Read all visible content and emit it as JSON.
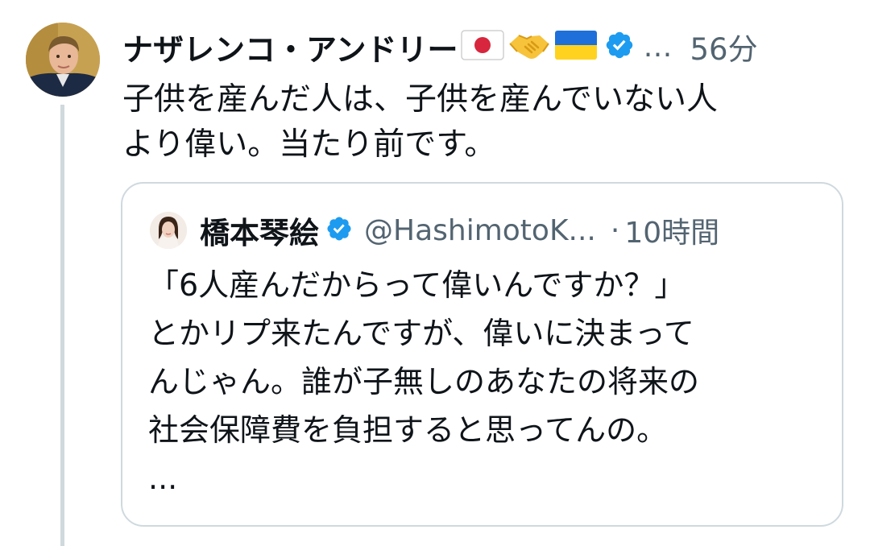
{
  "post": {
    "author_name": "ナザレンコ・アンドリー",
    "ellipsis": "…",
    "time": "56分",
    "text_lines": [
      "子供を産んだ人は、子供を産んでいない人",
      "より偉い。当たり前です。"
    ],
    "icons": [
      "japan-flag-icon",
      "handshake-icon",
      "ukraine-flag-icon",
      "verified-badge-icon"
    ]
  },
  "quote": {
    "author_name": "橋本琴絵",
    "handle": "@HashimotoK...",
    "separator": "·",
    "time": "10時間",
    "text_lines": [
      "「6人産んだからって偉いんですか？」",
      "とかリプ来たんですが、偉いに決まって",
      "んじゃん。誰が子無しのあなたの将来の",
      "社会保障費を負担すると思ってんの。",
      "..."
    ]
  },
  "colors": {
    "text_primary": "#0f1419",
    "text_secondary": "#536471",
    "verified_blue": "#1d9bf0",
    "border": "#cfd9de"
  }
}
